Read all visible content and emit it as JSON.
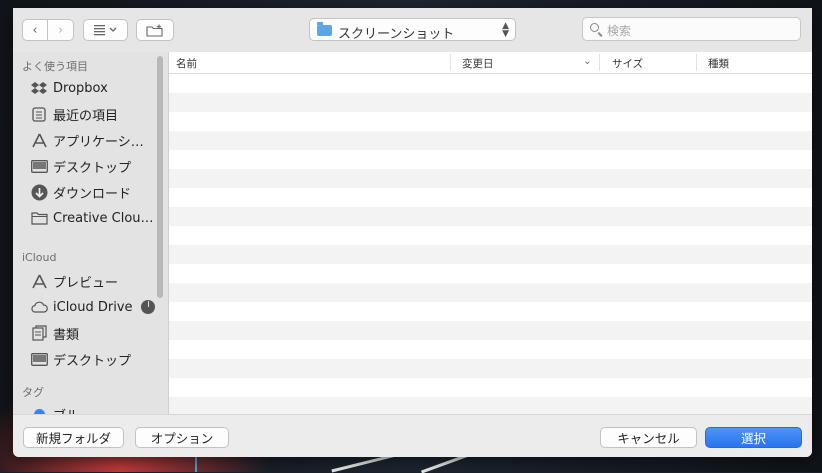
{
  "toolbar": {
    "back_label": "‹",
    "forward_label": "›",
    "current_folder": "スクリーンショット",
    "search_placeholder": "検索"
  },
  "sidebar": {
    "favorites_heading": "よく使う項目",
    "favorites": [
      {
        "label": "Dropbox",
        "icon": "dropbox-icon"
      },
      {
        "label": "最近の項目",
        "icon": "recents-icon"
      },
      {
        "label": "アプリケーシ…",
        "icon": "applications-icon"
      },
      {
        "label": "デスクトップ",
        "icon": "desktop-icon"
      },
      {
        "label": "ダウンロード",
        "icon": "downloads-icon"
      },
      {
        "label": "Creative Clou…",
        "icon": "folder-icon"
      }
    ],
    "icloud_heading": "iCloud",
    "icloud": [
      {
        "label": "プレビュー",
        "icon": "preview-icon"
      },
      {
        "label": "iCloud Drive",
        "icon": "cloud-icon"
      },
      {
        "label": "書類",
        "icon": "documents-icon"
      },
      {
        "label": "デスクトップ",
        "icon": "desktop-icon"
      }
    ],
    "tags_heading": "タグ",
    "tags": [
      {
        "label": "ブルー",
        "color": "#3b82f6"
      }
    ]
  },
  "file_list": {
    "columns": [
      "名前",
      "変更日",
      "サイズ",
      "種類"
    ],
    "sorted_column": "変更日",
    "rows": []
  },
  "bottom_bar": {
    "new_folder_label": "新規フォルダ",
    "options_label": "オプション",
    "cancel_label": "キャンセル",
    "select_label": "選択"
  }
}
